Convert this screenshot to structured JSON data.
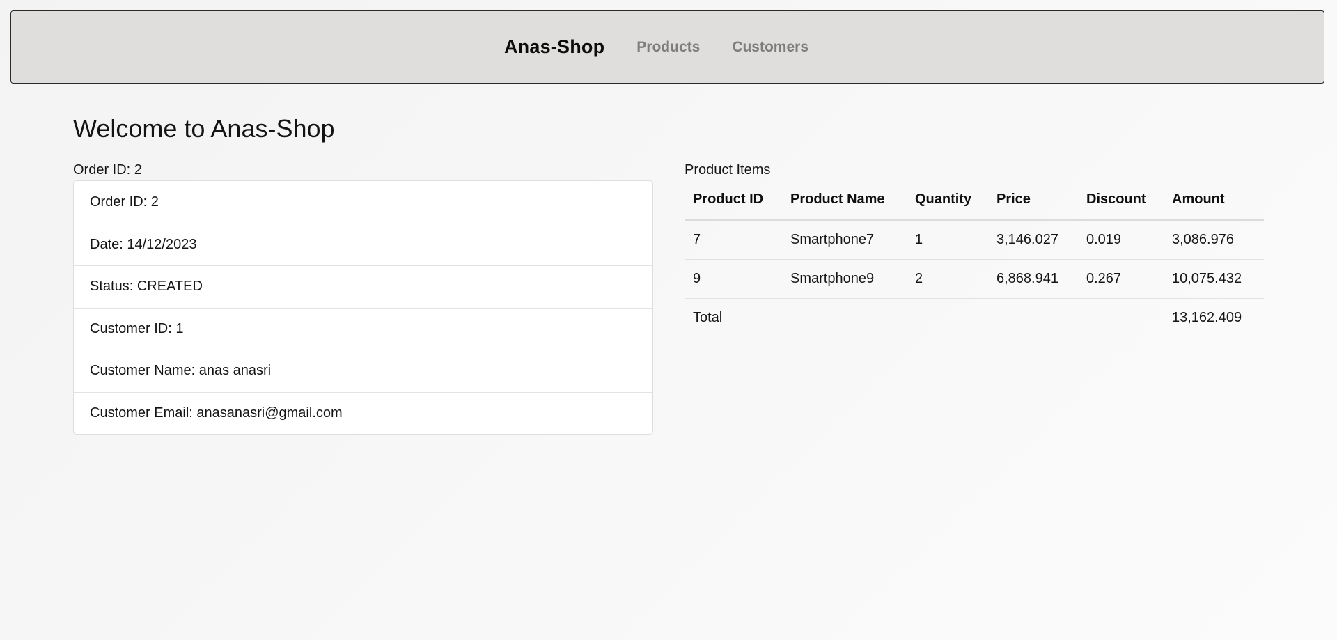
{
  "navbar": {
    "brand": "Anas-Shop",
    "links": [
      "Products",
      "Customers"
    ]
  },
  "page": {
    "title": "Welcome to Anas-Shop"
  },
  "order": {
    "caption": "Order ID: 2",
    "details": [
      "Order ID: 2",
      "Date: 14/12/2023",
      "Status: CREATED",
      "Customer ID: 1",
      "Customer Name: anas anasri",
      "Customer Email: anasanasri@gmail.com"
    ]
  },
  "product_items": {
    "caption": "Product Items",
    "columns": [
      "Product ID",
      "Product Name",
      "Quantity",
      "Price",
      "Discount",
      "Amount"
    ],
    "rows": [
      [
        "7",
        "Smartphone7",
        "1",
        "3,146.027",
        "0.019",
        "3,086.976"
      ],
      [
        "9",
        "Smartphone9",
        "2",
        "6,868.941",
        "0.267",
        "10,075.432"
      ]
    ],
    "total_label": "Total",
    "total_amount": "13,162.409"
  },
  "colors": {
    "navbar_bg": "#dfdedc",
    "nav_link": "#7d7d7d",
    "brand": "#0c0c0c"
  }
}
